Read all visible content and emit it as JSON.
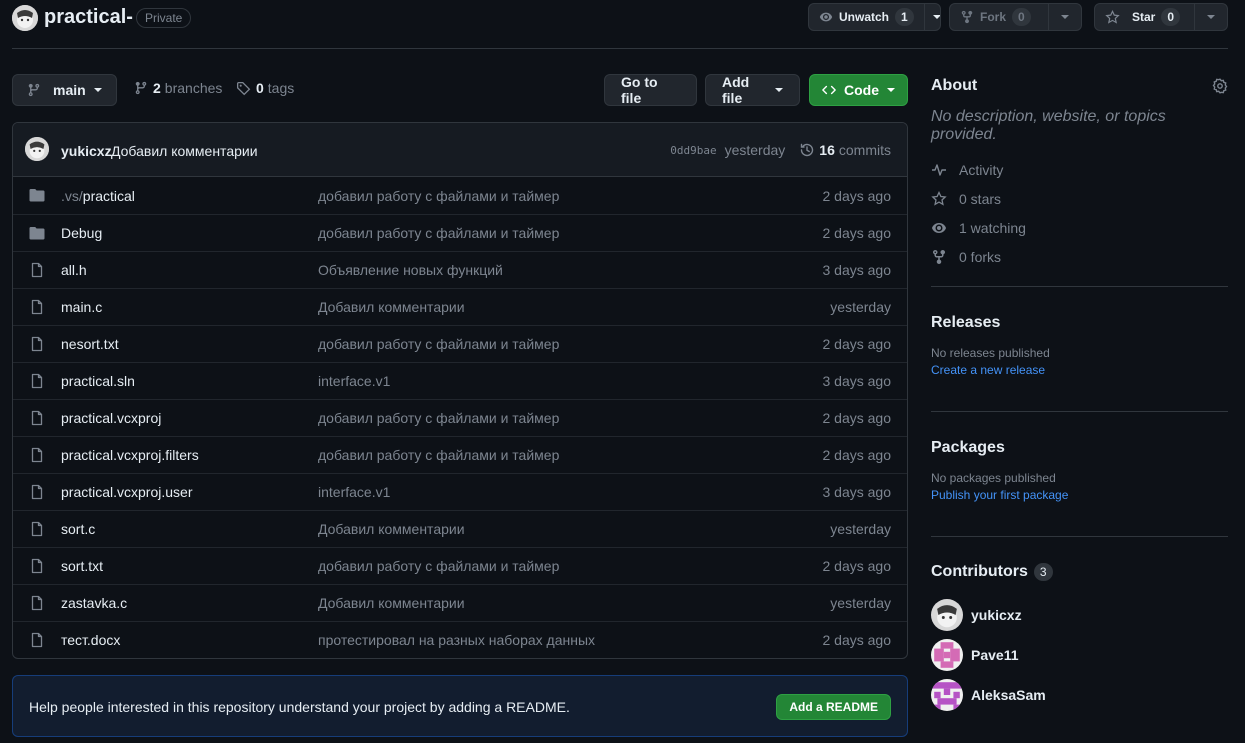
{
  "repo": {
    "name": "practical-",
    "visibility": "Private"
  },
  "actions": {
    "watch_label": "Unwatch",
    "watch_count": "1",
    "fork_label": "Fork",
    "fork_count": "0",
    "star_label": "Star",
    "star_count": "0"
  },
  "toolbar": {
    "branch": "main",
    "branches_count": "2",
    "branches_label": "branches",
    "tags_count": "0",
    "tags_label": "tags",
    "go_to_file": "Go to file",
    "add_file": "Add file",
    "code": "Code"
  },
  "latest_commit": {
    "author": "yukicxz",
    "message": "Добавил комментарии",
    "sha": "0dd9bae",
    "when": "yesterday",
    "commits_count": "16",
    "commits_label": "commits"
  },
  "files": [
    {
      "dir": ".vs/",
      "name": "practical",
      "type": "folder",
      "commit": "добавил работу с файлами и таймер",
      "age": "2 days ago"
    },
    {
      "dir": "",
      "name": "Debug",
      "type": "folder",
      "commit": "добавил работу с файлами и таймер",
      "age": "2 days ago"
    },
    {
      "dir": "",
      "name": "all.h",
      "type": "file",
      "commit": "Объявление новых функций",
      "age": "3 days ago"
    },
    {
      "dir": "",
      "name": "main.c",
      "type": "file",
      "commit": "Добавил комментарии",
      "age": "yesterday"
    },
    {
      "dir": "",
      "name": "nesort.txt",
      "type": "file",
      "commit": "добавил работу с файлами и таймер",
      "age": "2 days ago"
    },
    {
      "dir": "",
      "name": "practical.sln",
      "type": "file",
      "commit": "interface.v1",
      "age": "3 days ago"
    },
    {
      "dir": "",
      "name": "practical.vcxproj",
      "type": "file",
      "commit": "добавил работу с файлами и таймер",
      "age": "2 days ago"
    },
    {
      "dir": "",
      "name": "practical.vcxproj.filters",
      "type": "file",
      "commit": "добавил работу с файлами и таймер",
      "age": "2 days ago"
    },
    {
      "dir": "",
      "name": "practical.vcxproj.user",
      "type": "file",
      "commit": "interface.v1",
      "age": "3 days ago"
    },
    {
      "dir": "",
      "name": "sort.c",
      "type": "file",
      "commit": "Добавил комментарии",
      "age": "yesterday"
    },
    {
      "dir": "",
      "name": "sort.txt",
      "type": "file",
      "commit": "добавил работу с файлами и таймер",
      "age": "2 days ago"
    },
    {
      "dir": "",
      "name": "zastavka.c",
      "type": "file",
      "commit": "Добавил комментарии",
      "age": "yesterday"
    },
    {
      "dir": "",
      "name": "тест.docx",
      "type": "file",
      "commit": "протестировал на разных наборах данных",
      "age": "2 days ago"
    }
  ],
  "readme_prompt": {
    "text": "Help people interested in this repository understand your project by adding a README.",
    "button": "Add a README"
  },
  "about": {
    "title": "About",
    "description": "No description, website, or topics provided.",
    "activity": "Activity",
    "stars": "0 stars",
    "watching": "1 watching",
    "forks": "0 forks"
  },
  "releases": {
    "title": "Releases",
    "none": "No releases published",
    "create": "Create a new release"
  },
  "packages": {
    "title": "Packages",
    "none": "No packages published",
    "publish": "Publish your first package"
  },
  "contributors": {
    "title": "Contributors",
    "count": "3",
    "people": [
      {
        "name": "yukicxz"
      },
      {
        "name": "Pave11"
      },
      {
        "name": "AleksaSam"
      }
    ]
  },
  "colors": {
    "background": "#0d1117",
    "border": "#30363d",
    "accent_green": "#238636",
    "link": "#4493f8"
  }
}
